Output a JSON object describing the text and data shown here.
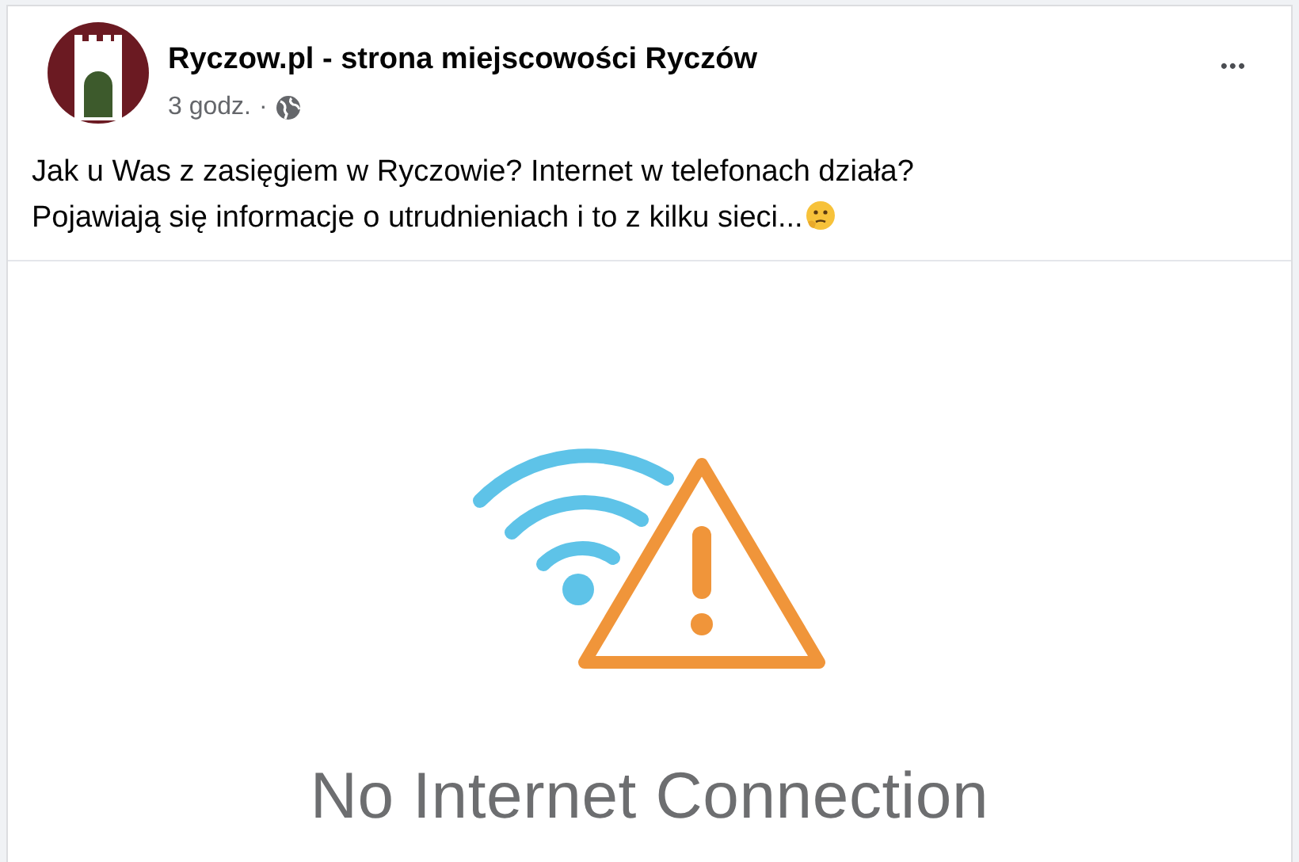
{
  "post": {
    "page_name": "Ryczow.pl - strona miejscowości Ryczów",
    "time": "3 godz.",
    "separator": "·",
    "more": "•••",
    "text_lines": [
      "Jak u Was z zasięgiem w Ryczowie? Internet w telefonach działa?",
      "Pojawiają się informacje o utrudnieniach i to z kilku sieci..."
    ]
  },
  "image": {
    "caption": "No Internet Connection"
  }
}
